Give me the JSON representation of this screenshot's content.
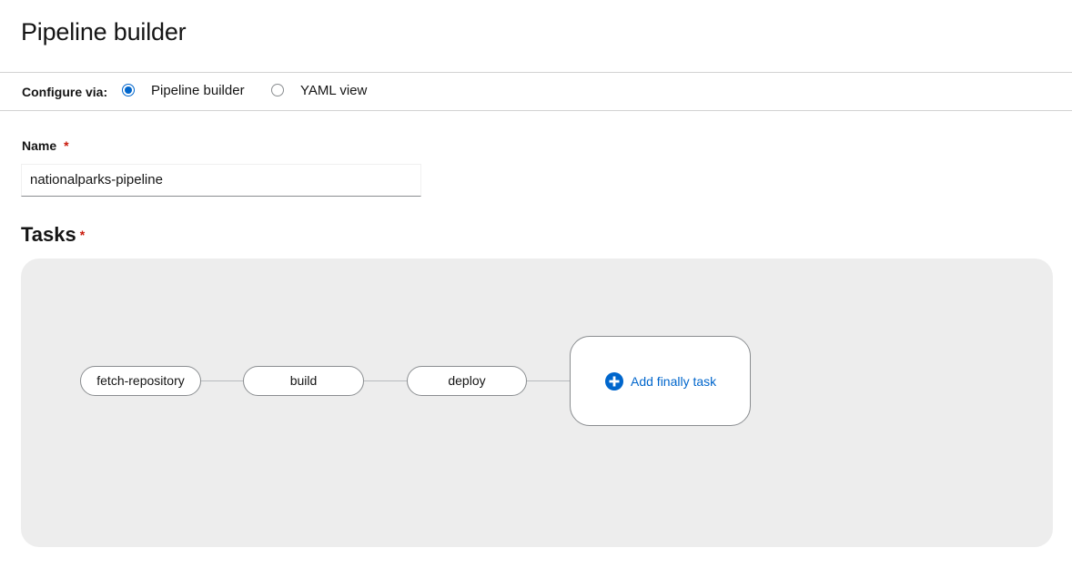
{
  "page": {
    "title": "Pipeline builder"
  },
  "configure": {
    "label": "Configure via:",
    "options": [
      {
        "label": "Pipeline builder",
        "selected": true
      },
      {
        "label": "YAML view",
        "selected": false
      }
    ]
  },
  "name_field": {
    "label": "Name",
    "required_marker": "*",
    "value": "nationalparks-pipeline"
  },
  "tasks": {
    "title": "Tasks",
    "required_marker": "*",
    "nodes": [
      "fetch-repository",
      "build",
      "deploy"
    ],
    "add_finally_label": "Add finally task"
  },
  "colors": {
    "accent": "#0066cc",
    "required": "#c9190b",
    "canvas_bg": "#ededed"
  }
}
